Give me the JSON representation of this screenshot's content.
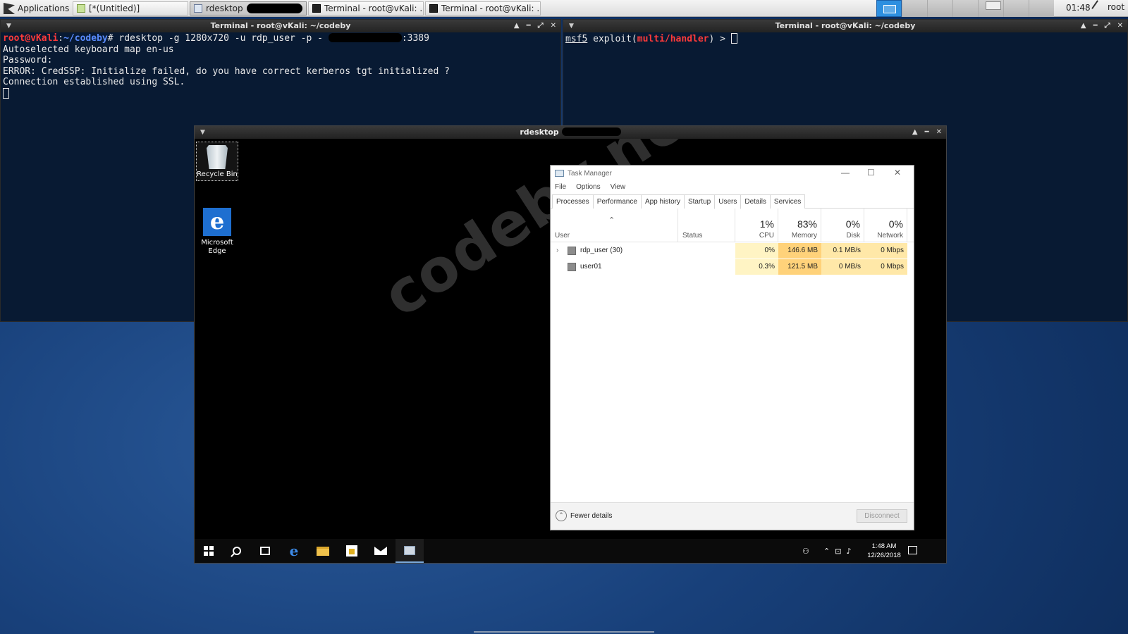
{
  "top_panel": {
    "applications_label": "Applications",
    "tasks": [
      {
        "label": "[*(Untitled)]",
        "icon": "text-editor-icon"
      },
      {
        "label": "rdesktop",
        "icon": "rdesktop-icon",
        "redacted": true
      },
      {
        "label": "Terminal - root@vKali: ...",
        "icon": "terminal-icon"
      },
      {
        "label": "Terminal - root@vKali: ...",
        "icon": "terminal-icon"
      }
    ],
    "clock": "01:48",
    "user": "root"
  },
  "left_terminal": {
    "title": "Terminal - root@vKali: ~/codeby",
    "prompt_user": "root@vKali",
    "prompt_sep": ":",
    "prompt_path": "~/codeby",
    "prompt_end": "# ",
    "command": "rdesktop -g 1280x720 -u rdp_user -p - ",
    "command_suffix": ":3389",
    "lines": [
      "Autoselected keyboard map en-us",
      "Password:",
      "ERROR: CredSSP: Initialize failed, do you have correct kerberos tgt initialized ?",
      "Connection established using SSL."
    ]
  },
  "right_terminal": {
    "title": "Terminal - root@vKali: ~/codeby",
    "prompt_msf": "msf5",
    "prompt_mid": " exploit(",
    "prompt_module": "multi/handler",
    "prompt_end": ") > "
  },
  "rdesktop": {
    "title": "rdesktop",
    "desktop_icons": [
      {
        "label": "Recycle Bin",
        "icon": "recycle-bin-icon"
      },
      {
        "label": "Microsoft Edge",
        "icon": "edge-icon"
      }
    ],
    "watermark": "codeby.net"
  },
  "task_manager": {
    "title": "Task Manager",
    "menus": [
      "File",
      "Options",
      "View"
    ],
    "tabs": [
      "Processes",
      "Performance",
      "App history",
      "Startup",
      "Users",
      "Details",
      "Services"
    ],
    "active_tab": "Users",
    "columns": {
      "user": "User",
      "status": "Status",
      "cpu": {
        "pct": "1%",
        "label": "CPU"
      },
      "memory": {
        "pct": "83%",
        "label": "Memory"
      },
      "disk": {
        "pct": "0%",
        "label": "Disk"
      },
      "network": {
        "pct": "0%",
        "label": "Network"
      }
    },
    "rows": [
      {
        "user": "rdp_user (30)",
        "status": "",
        "cpu": "0%",
        "memory": "146.6 MB",
        "disk": "0.1 MB/s",
        "network": "0 Mbps",
        "expandable": true
      },
      {
        "user": "user01",
        "status": "",
        "cpu": "0.3%",
        "memory": "121.5 MB",
        "disk": "0 MB/s",
        "network": "0 Mbps",
        "expandable": false
      }
    ],
    "fewer_details": "Fewer details",
    "disconnect": "Disconnect"
  },
  "win_taskbar": {
    "time": "1:48 AM",
    "date": "12/26/2018"
  },
  "colors": {
    "heat_low": "#fff4c4",
    "heat_mid": "#ffe8a8",
    "heat_high": "#ffd27a",
    "terminal_bg": "#081a33",
    "prompt_red": "#ff3a3a",
    "prompt_blue": "#5a8cff"
  }
}
